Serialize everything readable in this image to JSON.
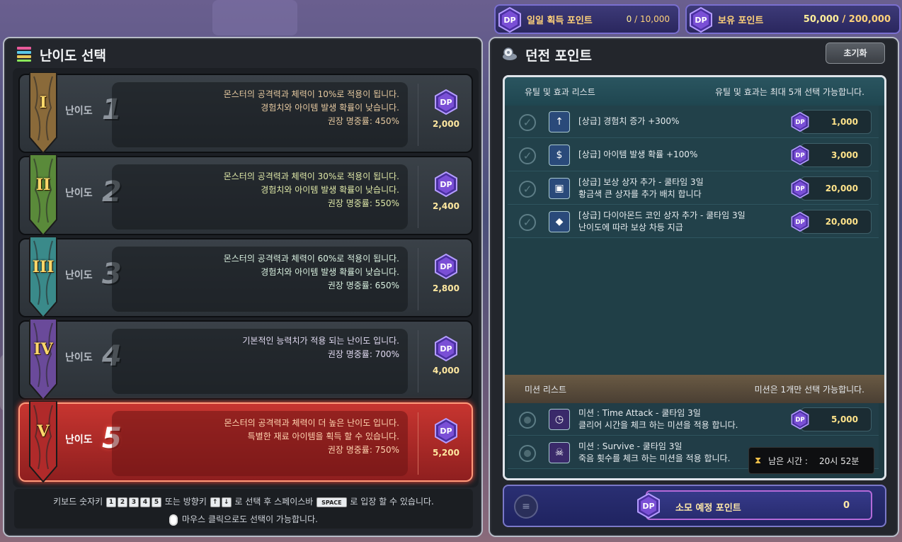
{
  "top_bars": {
    "daily": {
      "label": "일일 획득 포인트",
      "current": "0",
      "sep": "/",
      "max": "10,000"
    },
    "owned": {
      "label": "보유 포인트",
      "current": "50,000",
      "sep": "/",
      "max": "200,000"
    }
  },
  "left_panel": {
    "title": "난이도 선택",
    "difficulty_label": "난이도",
    "rows": [
      {
        "roman": "I",
        "num": "1",
        "lines": [
          "몬스터의 공격력과 체력이 10%로 적용이 됩니다.",
          "경험치와 아이템 발생 확률이 낮습니다.",
          "권장 명중률: 450%"
        ],
        "cost": "2,000"
      },
      {
        "roman": "II",
        "num": "2",
        "lines": [
          "몬스터의 공격력과 체력이 30%로 적용이 됩니다.",
          "경험치와 아이템 발생 확률이 낮습니다.",
          "권장 명중률: 550%"
        ],
        "cost": "2,400"
      },
      {
        "roman": "III",
        "num": "3",
        "lines": [
          "몬스터의 공격력과 체력이 60%로 적용이 됩니다.",
          "경험치와 아이템 발생 확률이 낮습니다.",
          "권장 명중률: 650%"
        ],
        "cost": "2,800"
      },
      {
        "roman": "IV",
        "num": "4",
        "lines": [
          "기본적인 능력치가 적용 되는 난이도 입니다.",
          "권장 명중률: 700%"
        ],
        "cost": "4,000"
      },
      {
        "roman": "V",
        "num": "5",
        "lines": [
          "몬스터의 공격력과 체력이 더 높은 난이도 입니다.",
          "특별한 재료 아이템을 획득 할 수 있습니다.",
          "권장 명중률: 750%"
        ],
        "cost": "5,200"
      }
    ],
    "selected_index": 4,
    "help": {
      "line1_prefix": "키보드 숫자키",
      "keys": [
        "1",
        "2",
        "3",
        "4",
        "5"
      ],
      "line1_mid": "또는 방향키",
      "arrow_up": "↑",
      "arrow_down": "↓",
      "line1_mid2": "로 선택 후 스페이스바",
      "space_key": "SPACE",
      "line1_suffix": "로 입장 할 수 있습니다.",
      "line2": "마우스 클릭으로도 선택이 가능합니다."
    }
  },
  "right_panel": {
    "title": "던전 포인트",
    "reset_label": "초기화",
    "util_header": {
      "left": "유틸 및 효과 리스트",
      "right": "유틸 및 효과는 최대 5개 선택 가능합니다."
    },
    "utils": [
      {
        "icon": "exp-icon",
        "glyph": "↑",
        "lines": [
          "[상급] 경험치 증가 +300%"
        ],
        "price": "1,000"
      },
      {
        "icon": "drop-rate-icon",
        "glyph": "$",
        "lines": [
          "[상급] 아이템 발생 확률 +100%"
        ],
        "price": "3,000"
      },
      {
        "icon": "reward-chest-icon",
        "glyph": "▣",
        "lines": [
          "[상급] 보상 상자 추가 - 쿨타임 3일",
          "황금색 큰 상자를 추가 배치 합니다"
        ],
        "price": "20,000"
      },
      {
        "icon": "diamond-coin-icon",
        "glyph": "◆",
        "lines": [
          "[상급] 다이아몬드 코인 상자 추가 - 쿨타임 3일",
          "난이도에 따라 보상 차등 지급"
        ],
        "price": "20,000"
      }
    ],
    "mission_header": {
      "left": "미션 리스트",
      "right": "미션은 1개만 선택 가능합니다."
    },
    "missions": [
      {
        "icon": "time-attack-icon",
        "glyph": "◷",
        "lines": [
          "미션 : Time Attack  - 쿨타임 3일",
          "클리어 시간을 체크 하는 미션을 적용 합니다."
        ],
        "price": "5,000"
      },
      {
        "icon": "survive-icon",
        "glyph": "☠",
        "lines": [
          "미션 : Survive  - 쿨타임 3일",
          "죽음 횟수를 체크 하는 미션을 적용 합니다."
        ],
        "price": ""
      }
    ],
    "tooltip": {
      "label": "남은 시간 :",
      "value": "20시 52분"
    },
    "spend": {
      "label": "소모 예정 포인트",
      "value": "0"
    }
  },
  "badge_text": "DP",
  "colors": {
    "accent_gold": "#ffd27a",
    "selected_red": "#c73530",
    "dp_purple": "#7a4fd6"
  }
}
